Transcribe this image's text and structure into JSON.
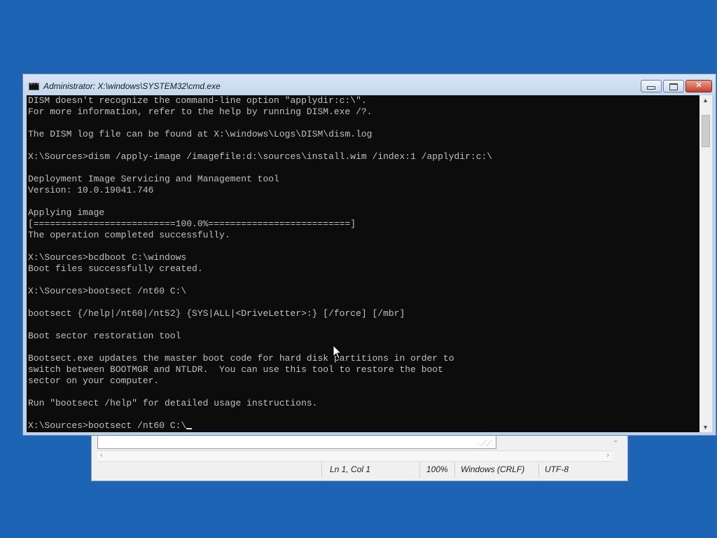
{
  "cmd_window": {
    "title": "Administrator: X:\\windows\\SYSTEM32\\cmd.exe",
    "icon": "C:\\",
    "controls": {
      "minimize": "minimize-icon",
      "maximize": "maximize-icon",
      "close": "✕"
    },
    "lines": [
      "DISM doesn't recognize the command-line option \"applydir:c:\\\".",
      "For more information, refer to the help by running DISM.exe /?.",
      "",
      "The DISM log file can be found at X:\\windows\\Logs\\DISM\\dism.log",
      "",
      "X:\\Sources>dism /apply-image /imagefile:d:\\sources\\install.wim /index:1 /applydir:c:\\",
      "",
      "Deployment Image Servicing and Management tool",
      "Version: 10.0.19041.746",
      "",
      "Applying image",
      "[==========================100.0%==========================]",
      "The operation completed successfully.",
      "",
      "X:\\Sources>bcdboot C:\\windows",
      "Boot files successfully created.",
      "",
      "X:\\Sources>bootsect /nt60 C:\\",
      "",
      "bootsect {/help|/nt60|/nt52} {SYS|ALL|<DriveLetter>:} [/force] [/mbr]",
      "",
      "Boot sector restoration tool",
      "",
      "Bootsect.exe updates the master boot code for hard disk partitions in order to",
      "switch between BOOTMGR and NTLDR.  You can use this tool to restore the boot",
      "sector on your computer.",
      "",
      "Run \"bootsect /help\" for detailed usage instructions.",
      "",
      "X:\\Sources>bootsect /nt60 C:\\"
    ]
  },
  "notepad": {
    "status": {
      "position": "Ln 1, Col 1",
      "zoom": "100%",
      "line_endings": "Windows (CRLF)",
      "encoding": "UTF-8"
    }
  }
}
